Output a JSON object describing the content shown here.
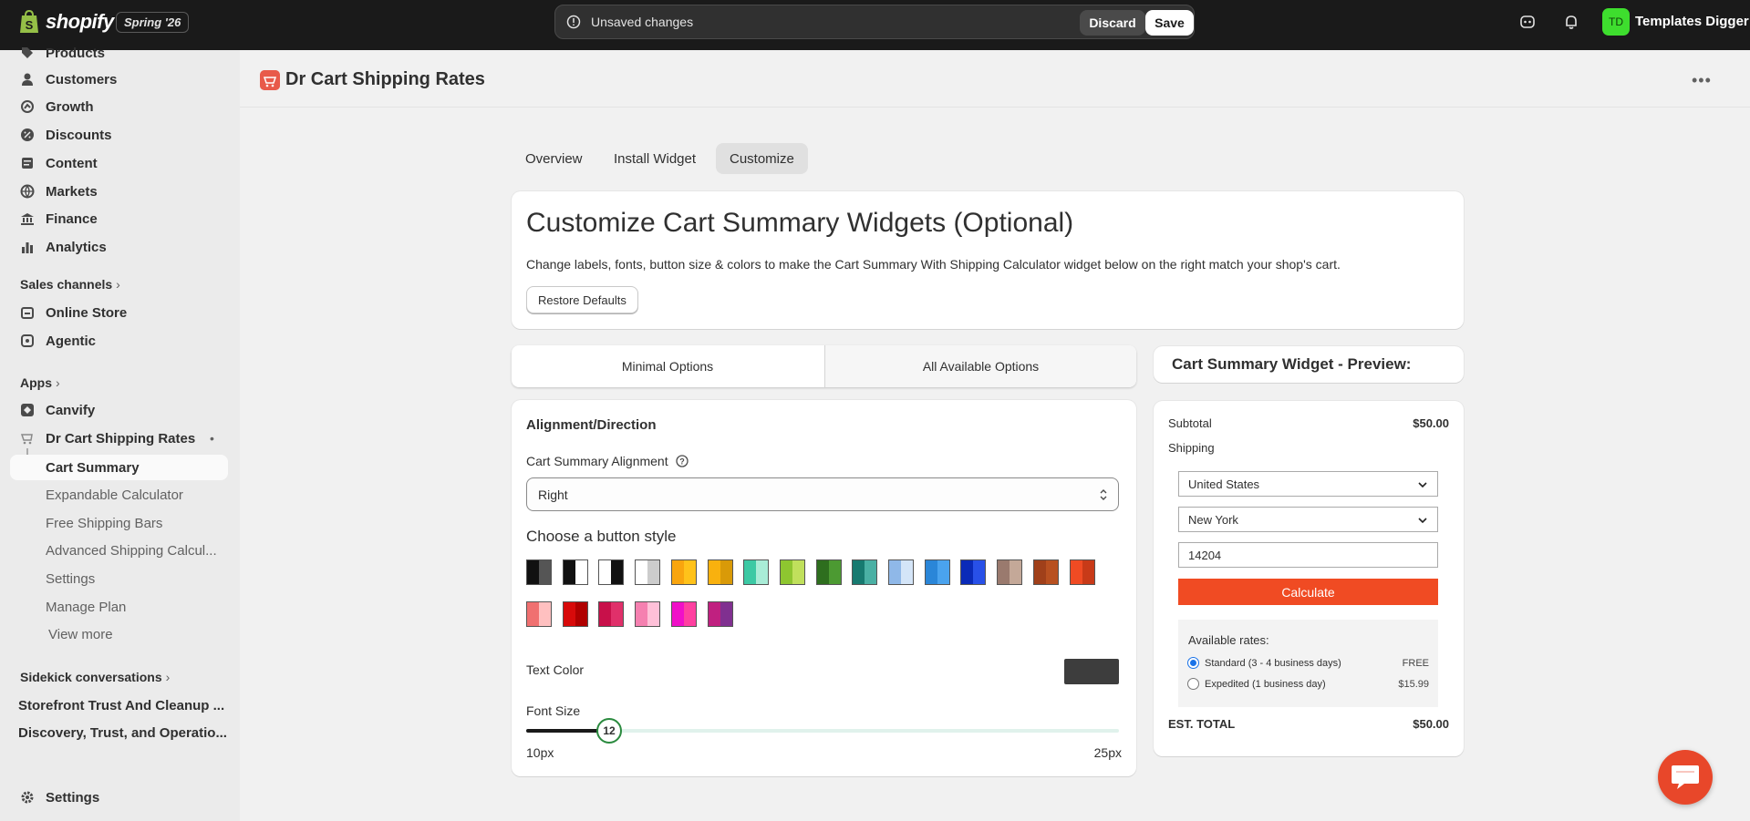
{
  "topbar": {
    "logo_text": "shopify",
    "edition": "Spring '26",
    "unsaved_text": "Unsaved changes",
    "discard_label": "Discard",
    "save_label": "Save",
    "avatar_initials": "TD",
    "store_name": "Templates Digger"
  },
  "sidebar": {
    "items": [
      {
        "label": "Products",
        "icon": "tag-icon"
      },
      {
        "label": "Customers",
        "icon": "person-icon"
      },
      {
        "label": "Growth",
        "icon": "growth-icon"
      },
      {
        "label": "Discounts",
        "icon": "discount-icon"
      },
      {
        "label": "Content",
        "icon": "content-icon"
      },
      {
        "label": "Markets",
        "icon": "globe-icon"
      },
      {
        "label": "Finance",
        "icon": "bank-icon"
      },
      {
        "label": "Analytics",
        "icon": "bar-chart-icon"
      }
    ],
    "sales_channels_label": "Sales channels",
    "sales_channels": [
      {
        "label": "Online Store",
        "icon": "store-icon"
      },
      {
        "label": "Agentic",
        "icon": "agentic-icon"
      }
    ],
    "apps_label": "Apps",
    "apps": [
      {
        "label": "Canvify",
        "icon": "canvify-icon"
      },
      {
        "label": "Dr Cart Shipping Rates",
        "icon": "app-icon"
      }
    ],
    "app_subitems": [
      "Cart Summary",
      "Expandable Calculator",
      "Free Shipping Bars",
      "Advanced Shipping Calcul...",
      "Settings",
      "Manage Plan",
      "View more"
    ],
    "sidekick_label": "Sidekick conversations",
    "conversations": [
      "Storefront Trust And Cleanup ...",
      "Discovery, Trust, and Operatio..."
    ],
    "settings_label": "Settings"
  },
  "page": {
    "app_title": "Dr Cart Shipping Rates",
    "tabs": [
      "Overview",
      "Install Widget",
      "Customize"
    ],
    "heading": "Customize Cart Summary Widgets (Optional)",
    "description": "Change labels, fonts, button size & colors to make the Cart Summary With Shipping Calculator widget below on the right match your shop's cart.",
    "restore_label": "Restore Defaults",
    "option_tabs": [
      "Minimal Options",
      "All Available Options"
    ]
  },
  "settings": {
    "section_title": "Alignment/Direction",
    "alignment_label": "Cart Summary Alignment",
    "alignment_value": "Right",
    "button_style_title": "Choose a button style",
    "swatches": [
      [
        "#111111",
        "#555555"
      ],
      [
        "#111111",
        "#ffffff"
      ],
      [
        "#ffffff",
        "#111111"
      ],
      [
        "#ffffff",
        "#cccccc"
      ],
      [
        "#f9a50e",
        "#ffc21a"
      ],
      [
        "#f9b10e",
        "#d99a08"
      ],
      [
        "#3cc9a4",
        "#a9ecd7"
      ],
      [
        "#8ec630",
        "#c0e05c"
      ],
      [
        "#2e6e1e",
        "#4c9a32"
      ],
      [
        "#177a70",
        "#4ab0a4"
      ],
      [
        "#8fb8e8",
        "#d4e5f8"
      ],
      [
        "#2a86d8",
        "#4aa3ee"
      ],
      [
        "#0a2ab8",
        "#2850e8"
      ],
      [
        "#9a7a6e",
        "#c4a898"
      ],
      [
        "#a0401a",
        "#b85020"
      ],
      [
        "#f04b23",
        "#c83a18"
      ],
      [
        "#f07070",
        "#ffc0c0"
      ],
      [
        "#d80a0a",
        "#b00000"
      ],
      [
        "#c8104a",
        "#e0306a"
      ],
      [
        "#f580b0",
        "#ffc0d8"
      ],
      [
        "#f010c8",
        "#ff40a0"
      ],
      [
        "#c02080",
        "#803090"
      ]
    ],
    "text_color_label": "Text Color",
    "text_color": "#3d3d3d",
    "font_size_label": "Font Size",
    "font_size_value": "12",
    "font_size_fraction": 0.14,
    "font_size_min": "10px",
    "font_size_max": "25px"
  },
  "preview": {
    "title": "Cart Summary Widget - Preview:",
    "subtotal_label": "Subtotal",
    "subtotal_value": "$50.00",
    "shipping_label": "Shipping",
    "country": "United States",
    "state": "New York",
    "zip": "14204",
    "calculate_label": "Calculate",
    "rates_title": "Available rates:",
    "rates": [
      {
        "label": "Standard (3 - 4 business days)",
        "price": "FREE",
        "selected": true
      },
      {
        "label": "Expedited (1 business day)",
        "price": "$15.99",
        "selected": false
      }
    ],
    "total_label": "EST. TOTAL",
    "total_value": "$50.00"
  }
}
